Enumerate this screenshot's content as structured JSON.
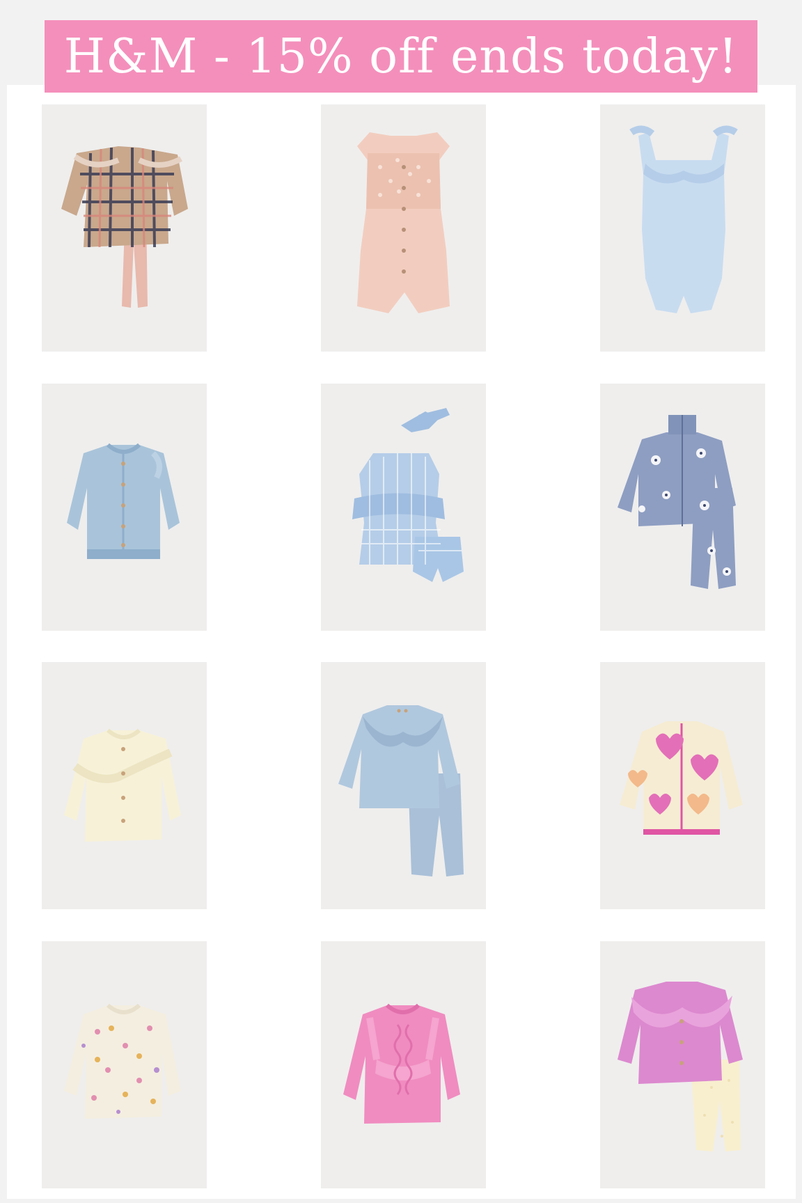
{
  "banner": {
    "text": "H&M - 15% off ends today!",
    "bg_color": "#f48fbb",
    "text_color": "#ffffff"
  },
  "products": [
    {
      "name": "plaid ruffle top and pink leggings set"
    },
    {
      "name": "peach eyelet romper"
    },
    {
      "name": "light blue ruffle bodysuit"
    },
    {
      "name": "light blue pointelle cardigan"
    },
    {
      "name": "blue gingham top, bloomers and headband set"
    },
    {
      "name": "blue floral fleece jacket and pants set"
    },
    {
      "name": "cream ruffle knit cardigan"
    },
    {
      "name": "blue ruffle collar top and leggings set"
    },
    {
      "name": "pink heart pile fleece jacket"
    },
    {
      "name": "cream polka dot knit sweater"
    },
    {
      "name": "pink cable knit ruffle sweater"
    },
    {
      "name": "pink ruffle top and cream leggings set"
    }
  ]
}
